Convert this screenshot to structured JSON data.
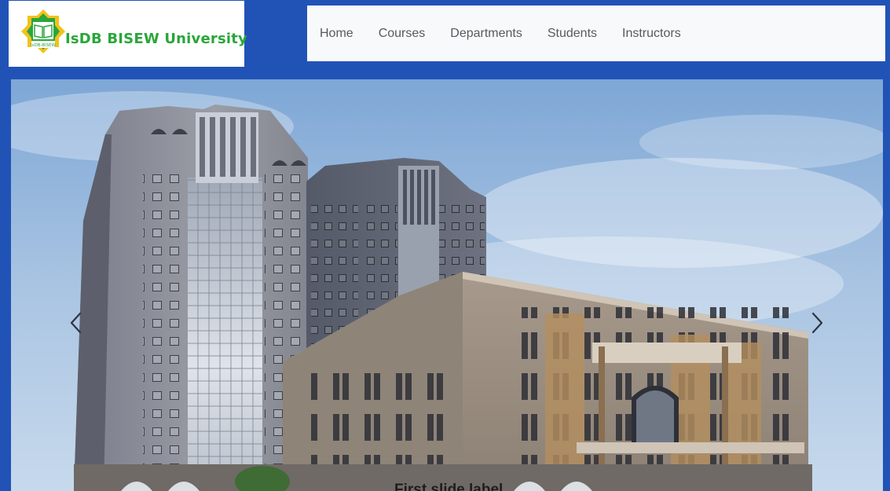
{
  "brand": {
    "emblem_text": "IsDB-BISEW",
    "name": "IsDB BISEW University",
    "color": "#2aa63a"
  },
  "nav": {
    "items": [
      {
        "label": "Home"
      },
      {
        "label": "Courses"
      },
      {
        "label": "Departments"
      },
      {
        "label": "Students"
      },
      {
        "label": "Instructors"
      }
    ]
  },
  "carousel": {
    "prev_icon": "chevron-left-icon",
    "next_icon": "chevron-right-icon",
    "caption": "First slide label"
  },
  "colors": {
    "page_background": "#2153b7",
    "navbar_background": "#f8f9fa",
    "nav_text": "#575a5e"
  }
}
